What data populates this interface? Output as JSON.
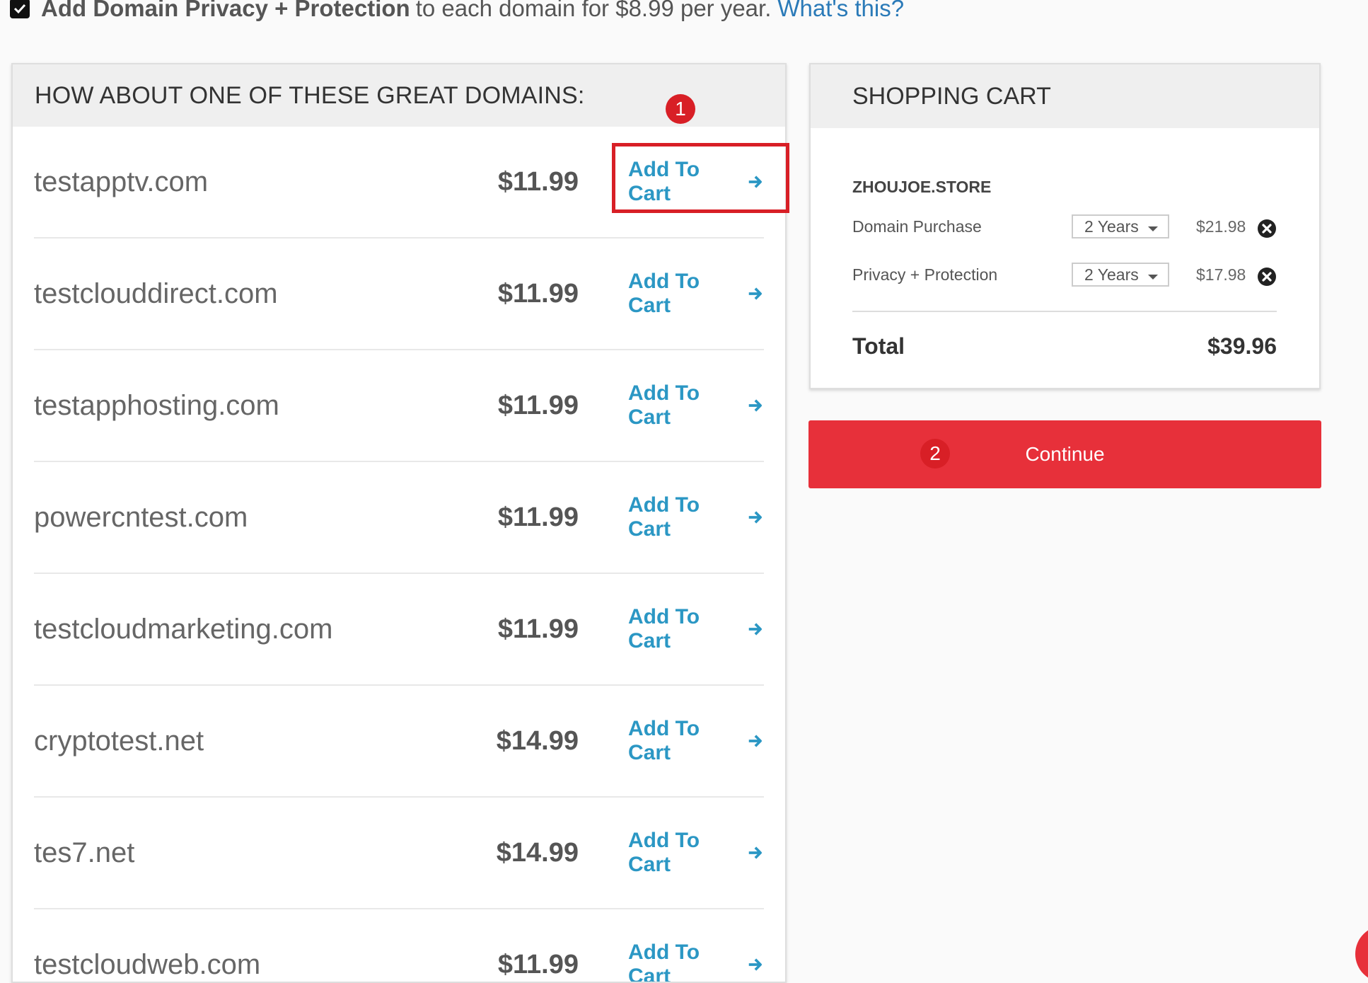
{
  "privacy": {
    "bold_text": "Add Domain Privacy + Protection",
    "text": "to each domain for $8.99 per year.",
    "link": "What's this?"
  },
  "suggestions": {
    "header": "HOW ABOUT ONE OF THESE GREAT DOMAINS:",
    "add_label": "Add To Cart",
    "items": [
      {
        "name": "testapptv.com",
        "price": "$11.99"
      },
      {
        "name": "testclouddirect.com",
        "price": "$11.99"
      },
      {
        "name": "testapphosting.com",
        "price": "$11.99"
      },
      {
        "name": "powercntest.com",
        "price": "$11.99"
      },
      {
        "name": "testcloudmarketing.com",
        "price": "$11.99"
      },
      {
        "name": "cryptotest.net",
        "price": "$14.99"
      },
      {
        "name": "tes7.net",
        "price": "$14.99"
      },
      {
        "name": "testcloudweb.com",
        "price": "$11.99"
      }
    ]
  },
  "cart": {
    "header": "SHOPPING CART",
    "domain": "ZHOUJOE.STORE",
    "lines": [
      {
        "label": "Domain Purchase",
        "term": "2 Years",
        "price": "$21.98"
      },
      {
        "label": "Privacy + Protection",
        "term": "2 Years",
        "price": "$17.98"
      }
    ],
    "total_label": "Total",
    "total_value": "$39.96"
  },
  "continue_label": "Continue",
  "markers": {
    "one": "1",
    "two": "2"
  },
  "colors": {
    "accent_red": "#e7303a",
    "link_blue": "#2b97c4",
    "highlight_red": "#d81f26"
  },
  "icons": [
    "check-icon",
    "arrow-right-icon",
    "remove-circle-icon",
    "caret-down-icon"
  ]
}
